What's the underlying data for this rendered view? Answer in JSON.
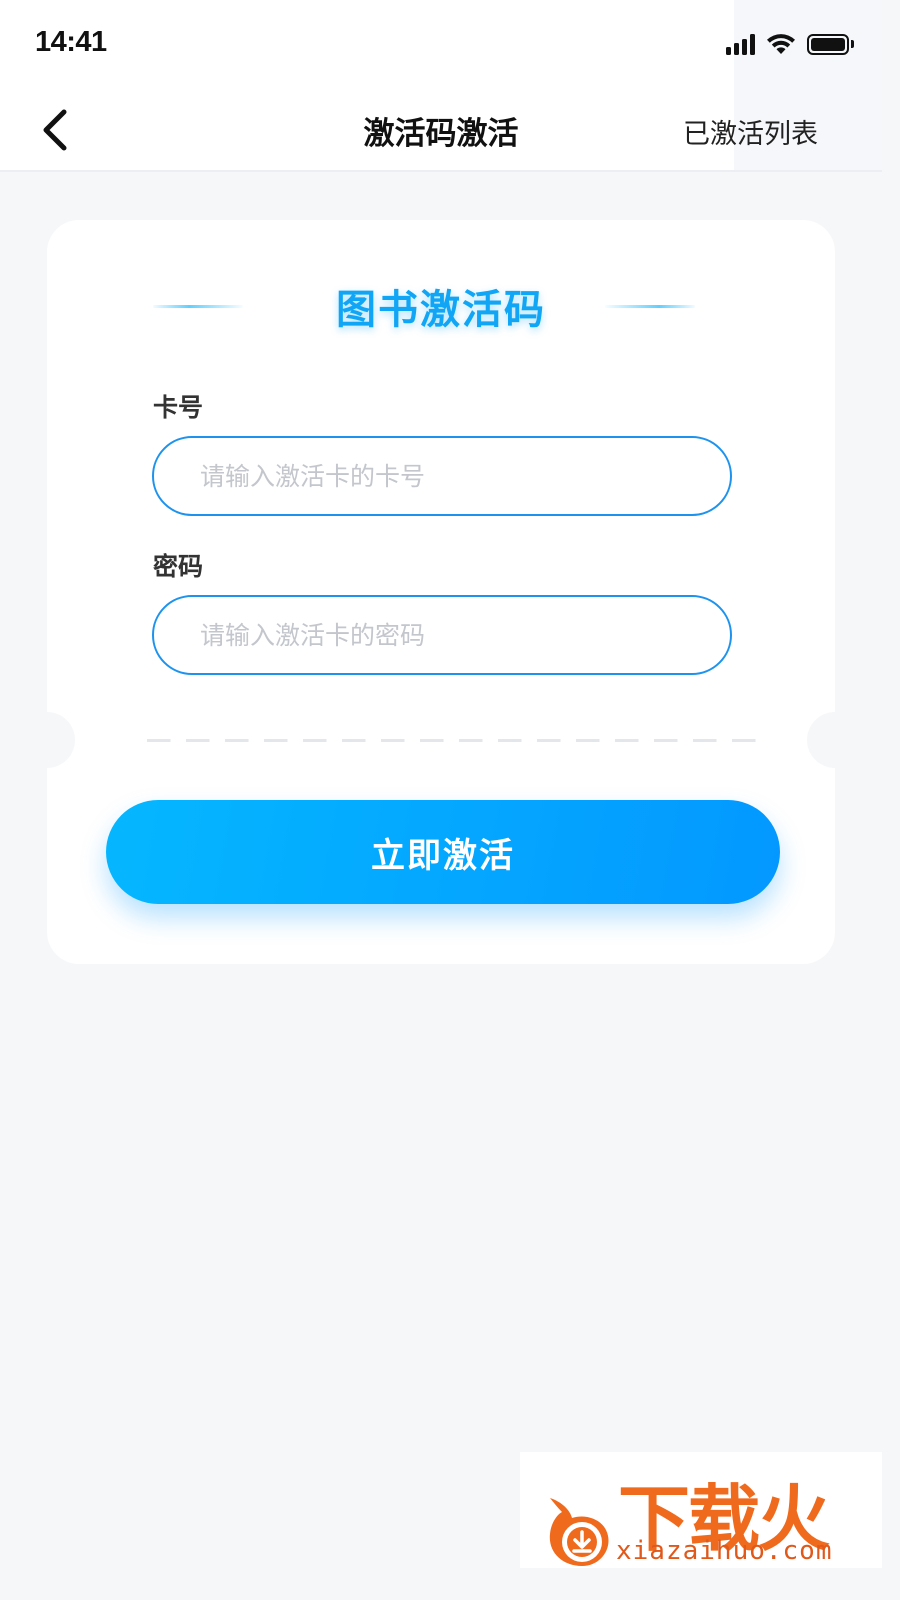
{
  "status_bar": {
    "time": "14:41"
  },
  "nav": {
    "title": "激活码激活",
    "right_link": "已激活列表"
  },
  "card": {
    "title": "图书激活码",
    "card_number": {
      "label": "卡号",
      "value": "",
      "placeholder": "请输入激活卡的卡号"
    },
    "password": {
      "label": "密码",
      "value": "",
      "placeholder": "请输入激活卡的密码"
    },
    "submit_label": "立即激活"
  },
  "watermark": {
    "brand": "下载火",
    "url": "xiazaihuo.com"
  },
  "colors": {
    "accent": "#10a6f5",
    "button_start": "#05b7ff",
    "button_end": "#0398ff",
    "input_border": "#1d93ee",
    "background": "#f6f7f9"
  },
  "icons": {
    "back": "chevron-left-icon",
    "signal": "cellular-signal-icon",
    "wifi": "wifi-icon",
    "battery": "battery-icon"
  }
}
